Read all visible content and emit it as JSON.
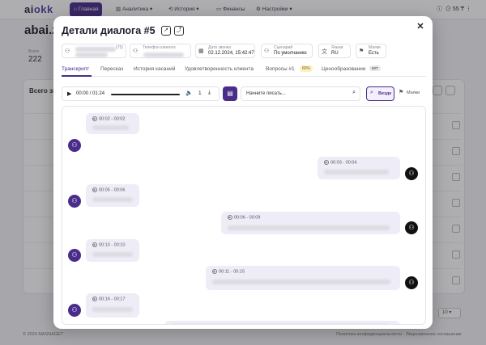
{
  "nav": {
    "logo_main": "ai",
    "logo_accent": "okk",
    "items": [
      {
        "label": "Главная"
      },
      {
        "label": "Аналитика"
      },
      {
        "label": "История"
      },
      {
        "label": "Финансы"
      },
      {
        "label": "Настройки"
      }
    ],
    "balance": "55 ₸"
  },
  "page": {
    "title": "abai.ze",
    "stat_label": "Всего",
    "stat_value": "222",
    "card_title": "Всего зв",
    "pager_value": "10",
    "footer_left": "© 2024 MASNAGET",
    "footer_right": "Политика конфиденциальности · Лицензионное соглашение"
  },
  "modal": {
    "title": "Детали диалога #5",
    "info": {
      "agent_suffix": "(75)",
      "phone_label": "Телефон клиента",
      "date_label": "Дата звонка",
      "date_value": "02.12.2024, 15:42:47",
      "scenario_label": "Сценарий",
      "scenario_value": "По умолчанию",
      "lang_label": "Языки",
      "lang_value": "RU",
      "marks_label": "Маяки",
      "marks_value": "Есть"
    },
    "tabs": [
      {
        "label": "Транскрипт"
      },
      {
        "label": "Пересказ"
      },
      {
        "label": "История касаний"
      },
      {
        "label": "Удовлетворенность клиента"
      },
      {
        "label": "Вопросы #1"
      },
      {
        "label": "Ценообразование"
      }
    ],
    "questions_badge": "80%",
    "pricing_badge": "60T",
    "player": {
      "time": "00:00 / 01:24",
      "speed": "1",
      "search_placeholder": "Начните писать..."
    },
    "all_button": "Везде",
    "marks_button": "Маяки",
    "messages": [
      {
        "side": "client",
        "time": "00:02 - 00:02"
      },
      {
        "side": "operator",
        "time": "00:03 - 00:04"
      },
      {
        "side": "client",
        "time": "00:05 - 00:06"
      },
      {
        "side": "operator",
        "time": "00:06 - 00:09"
      },
      {
        "side": "client",
        "time": "00:10 - 00:10"
      },
      {
        "side": "operator",
        "time": "00:11 - 00:15"
      },
      {
        "side": "client",
        "time": "00:16 - 00:17"
      }
    ]
  }
}
